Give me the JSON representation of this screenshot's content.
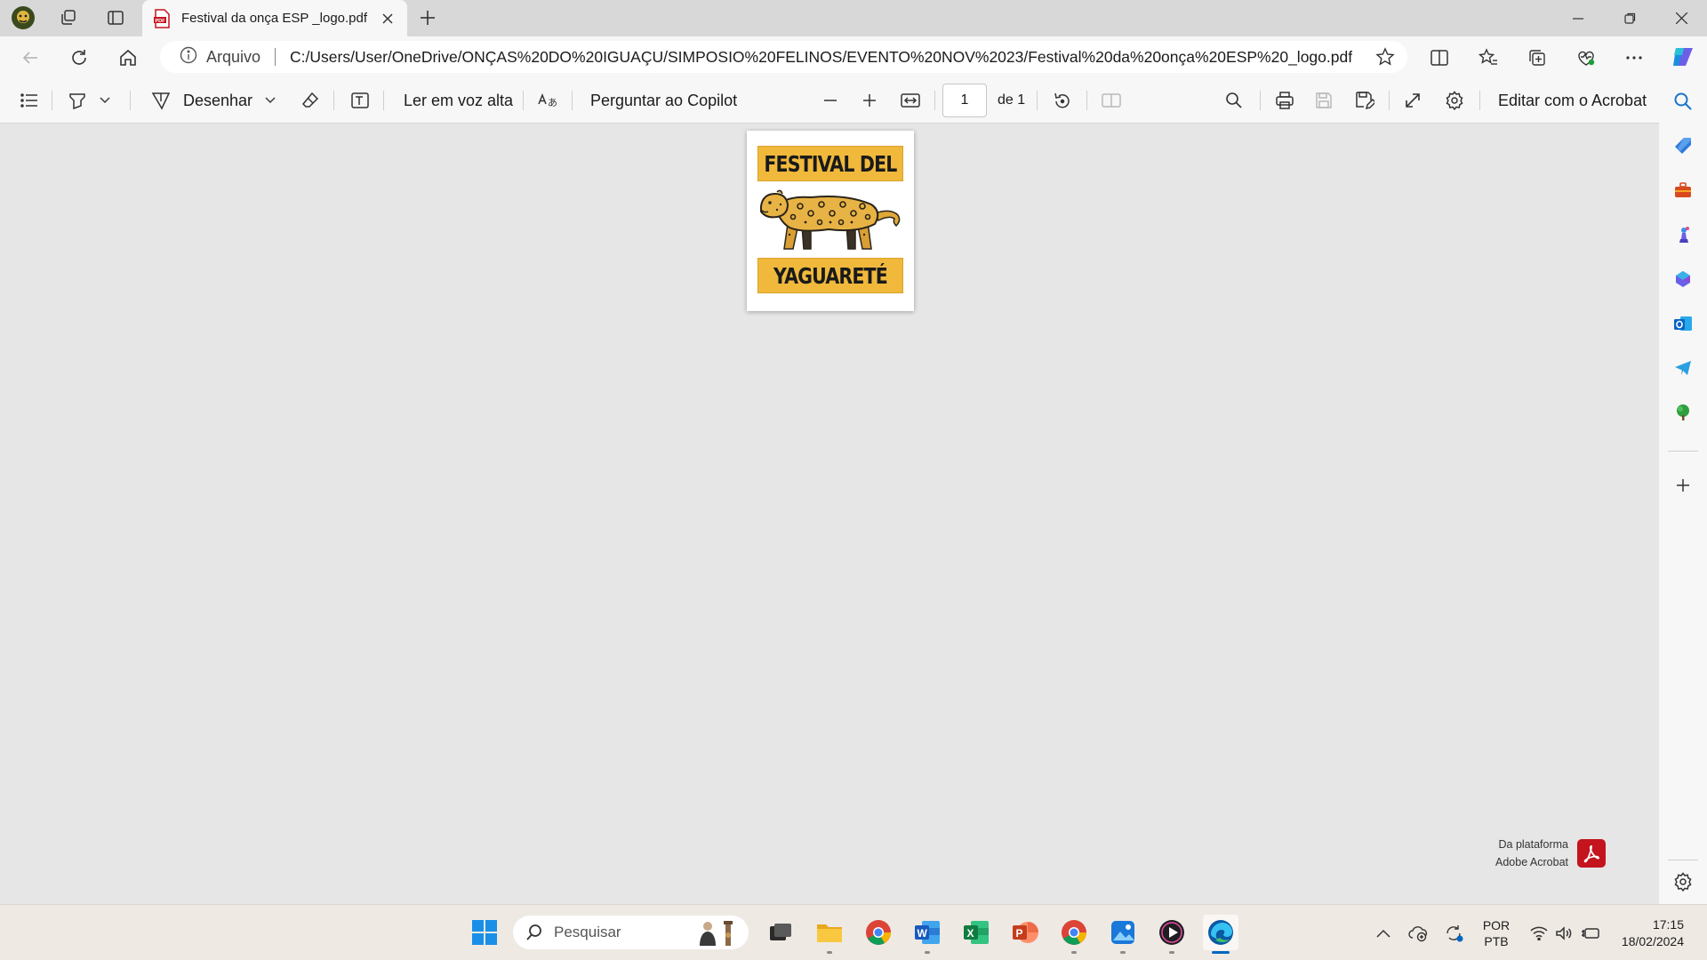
{
  "browser": {
    "tab_title": "Festival da onça ESP _logo.pdf",
    "address_label": "Arquivo",
    "url": "C:/Users/User/OneDrive/ONÇAS%20DO%20IGUAÇU/SIMPOSIO%20FELINOS/EVENTO%20NOV%2023/Festival%20da%20onça%20ESP%20_logo.pdf"
  },
  "pdf_toolbar": {
    "draw_label": "Desenhar",
    "read_aloud_label": "Ler em voz alta",
    "copilot_label": "Perguntar ao Copilot",
    "current_page": "1",
    "page_total": "de 1",
    "edit_acrobat_label": "Editar com o Acrobat"
  },
  "document": {
    "logo_line1": "FESTIVAL DEL",
    "logo_line2": "YAGUARETÉ"
  },
  "branding": {
    "line1": "Da plataforma",
    "line2": "Adobe Acrobat"
  },
  "taskbar": {
    "search_placeholder": "Pesquisar",
    "lang_line1": "POR",
    "lang_line2": "PTB",
    "time": "17:15",
    "date": "18/02/2024"
  },
  "colors": {
    "accent": "#0067c0",
    "logo_yellow": "#f0b93c",
    "acrobat_red": "#c4141e"
  }
}
